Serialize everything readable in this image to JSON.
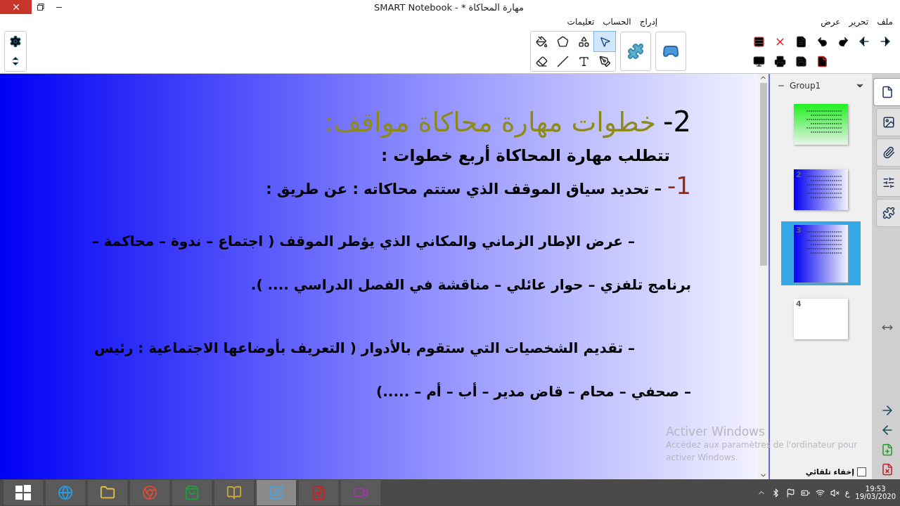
{
  "window": {
    "title": "مهارة المحاكاة * - SMART Notebook"
  },
  "menu": [
    "ملف",
    "تحرير",
    "عرض",
    "إدراج",
    "الحساب",
    "تعليمات"
  ],
  "toolbar": {
    "tools": [
      {
        "kind": "fill",
        "selected": false
      },
      {
        "kind": "shape",
        "selected": false
      },
      {
        "kind": "shapes",
        "selected": false
      },
      {
        "kind": "select",
        "selected": true
      },
      {
        "kind": "eraser",
        "selected": false
      },
      {
        "kind": "line",
        "selected": false
      },
      {
        "kind": "text",
        "selected": false
      },
      {
        "kind": "pens",
        "selected": false
      }
    ]
  },
  "slide": {
    "lines": [
      {
        "kind": "heading",
        "number": "2-",
        "text": "خطوات مهارة محاكاة مواقف:"
      },
      {
        "kind": "intro",
        "text": "تتطلب  مهارة المحاكاة أربع خطوات :"
      },
      {
        "kind": "step",
        "number": "1-",
        "text": "– تحديد سياق الموقف الذي ستتم محاكاته : عن طريق :"
      },
      {
        "kind": "paragraph",
        "text": "– عرض الإطار الزماني والمكاني الذي يؤطر الموقف ( اجتماع – ندوة – محاكمة – برنامج تلفزي – حوار عائلي – مناقشة في الفصل الدراسي .... )."
      },
      {
        "kind": "paragraph",
        "text": "– تقديم الشخصيات التي ستقوم بالأدوار ( التعريف بأوضاعها الاجتماعية : رئيس – صحفي – محام – قاض مدير – أب – أم – .....)"
      }
    ]
  },
  "activation": {
    "title": "Activer Windows",
    "text": "Accédez aux paramètres de l'ordinateur pour activer Windows."
  },
  "sorter": {
    "group": "Group1",
    "pages": [
      {
        "kind": "green",
        "selected": false
      },
      {
        "kind": "blue",
        "number": "2",
        "selected": false
      },
      {
        "kind": "blue",
        "number": "3",
        "selected": true
      },
      {
        "kind": "blank",
        "number": "4",
        "selected": false
      }
    ],
    "auto_hide": {
      "label": "إخفاء تلقائي",
      "checked": false
    }
  },
  "side_tabs": [
    {
      "kind": "page",
      "selected": true
    },
    {
      "kind": "gallery",
      "selected": false
    },
    {
      "kind": "attachments",
      "selected": false
    },
    {
      "kind": "properties",
      "selected": false
    },
    {
      "kind": "addons",
      "selected": false
    }
  ],
  "taskbar": {
    "apps": [
      {
        "kind": "ie",
        "selected": false
      },
      {
        "kind": "explorer",
        "selected": false
      },
      {
        "kind": "chrome",
        "selected": false
      },
      {
        "kind": "store",
        "selected": false
      },
      {
        "kind": "book",
        "selected": false
      },
      {
        "kind": "notebook",
        "selected": true
      },
      {
        "kind": "acrobat",
        "selected": false
      },
      {
        "kind": "recorder",
        "selected": false
      }
    ],
    "language": "ع",
    "time": "19:53",
    "date": "19/03/2020"
  }
}
